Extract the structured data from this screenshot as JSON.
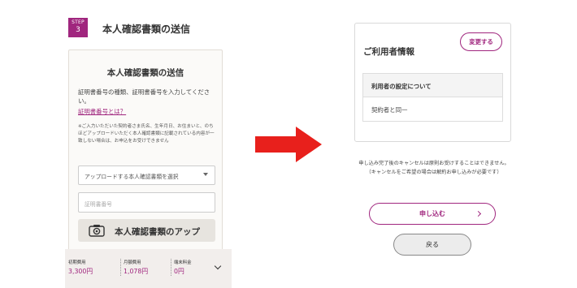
{
  "step": {
    "word": "STEP",
    "number": "3",
    "title": "本人確認書類の送信"
  },
  "doc_card": {
    "title": "本人確認書類の送信",
    "description": "証明書番号の種類、証明書番号を入力してください。",
    "help_link": "証明書番号とは？",
    "note": "※ご入力いただいた契約者さま氏名、生年月日、お住まいと、のちほどアップロードいただく本人確認書類に記載されている内容が一致しない場合は、お申込をお受けできません",
    "select_placeholder": "アップロードする本人確認書類を選択",
    "number_placeholder": "証明書番号",
    "upload_button": "本人確認書類のアップ"
  },
  "fees": [
    {
      "label": "初期費用",
      "value": "3,300円"
    },
    {
      "label": "月額費用",
      "value": "1,078円"
    },
    {
      "label": "端末料金",
      "value": "0円"
    }
  ],
  "user_info": {
    "title": "ご利用者情報",
    "change_button": "変更する",
    "table_header": "利用者の設定について",
    "table_value": "契約者と同一"
  },
  "cancel_note": {
    "line1": "申し込み完了後のキャンセルは原則お受けすることはできません。",
    "line2": "（キャンセルをご希望の場合は解約お申し込みが必要です）"
  },
  "actions": {
    "apply": "申し込む",
    "back": "戻る"
  },
  "colors": {
    "accent": "#a0267e",
    "arrow": "#e8201c",
    "fee_bar": "#f2eeec"
  },
  "icons": [
    "camera-icon",
    "chevron-down-icon",
    "chevron-right-icon",
    "arrow-right-icon"
  ]
}
